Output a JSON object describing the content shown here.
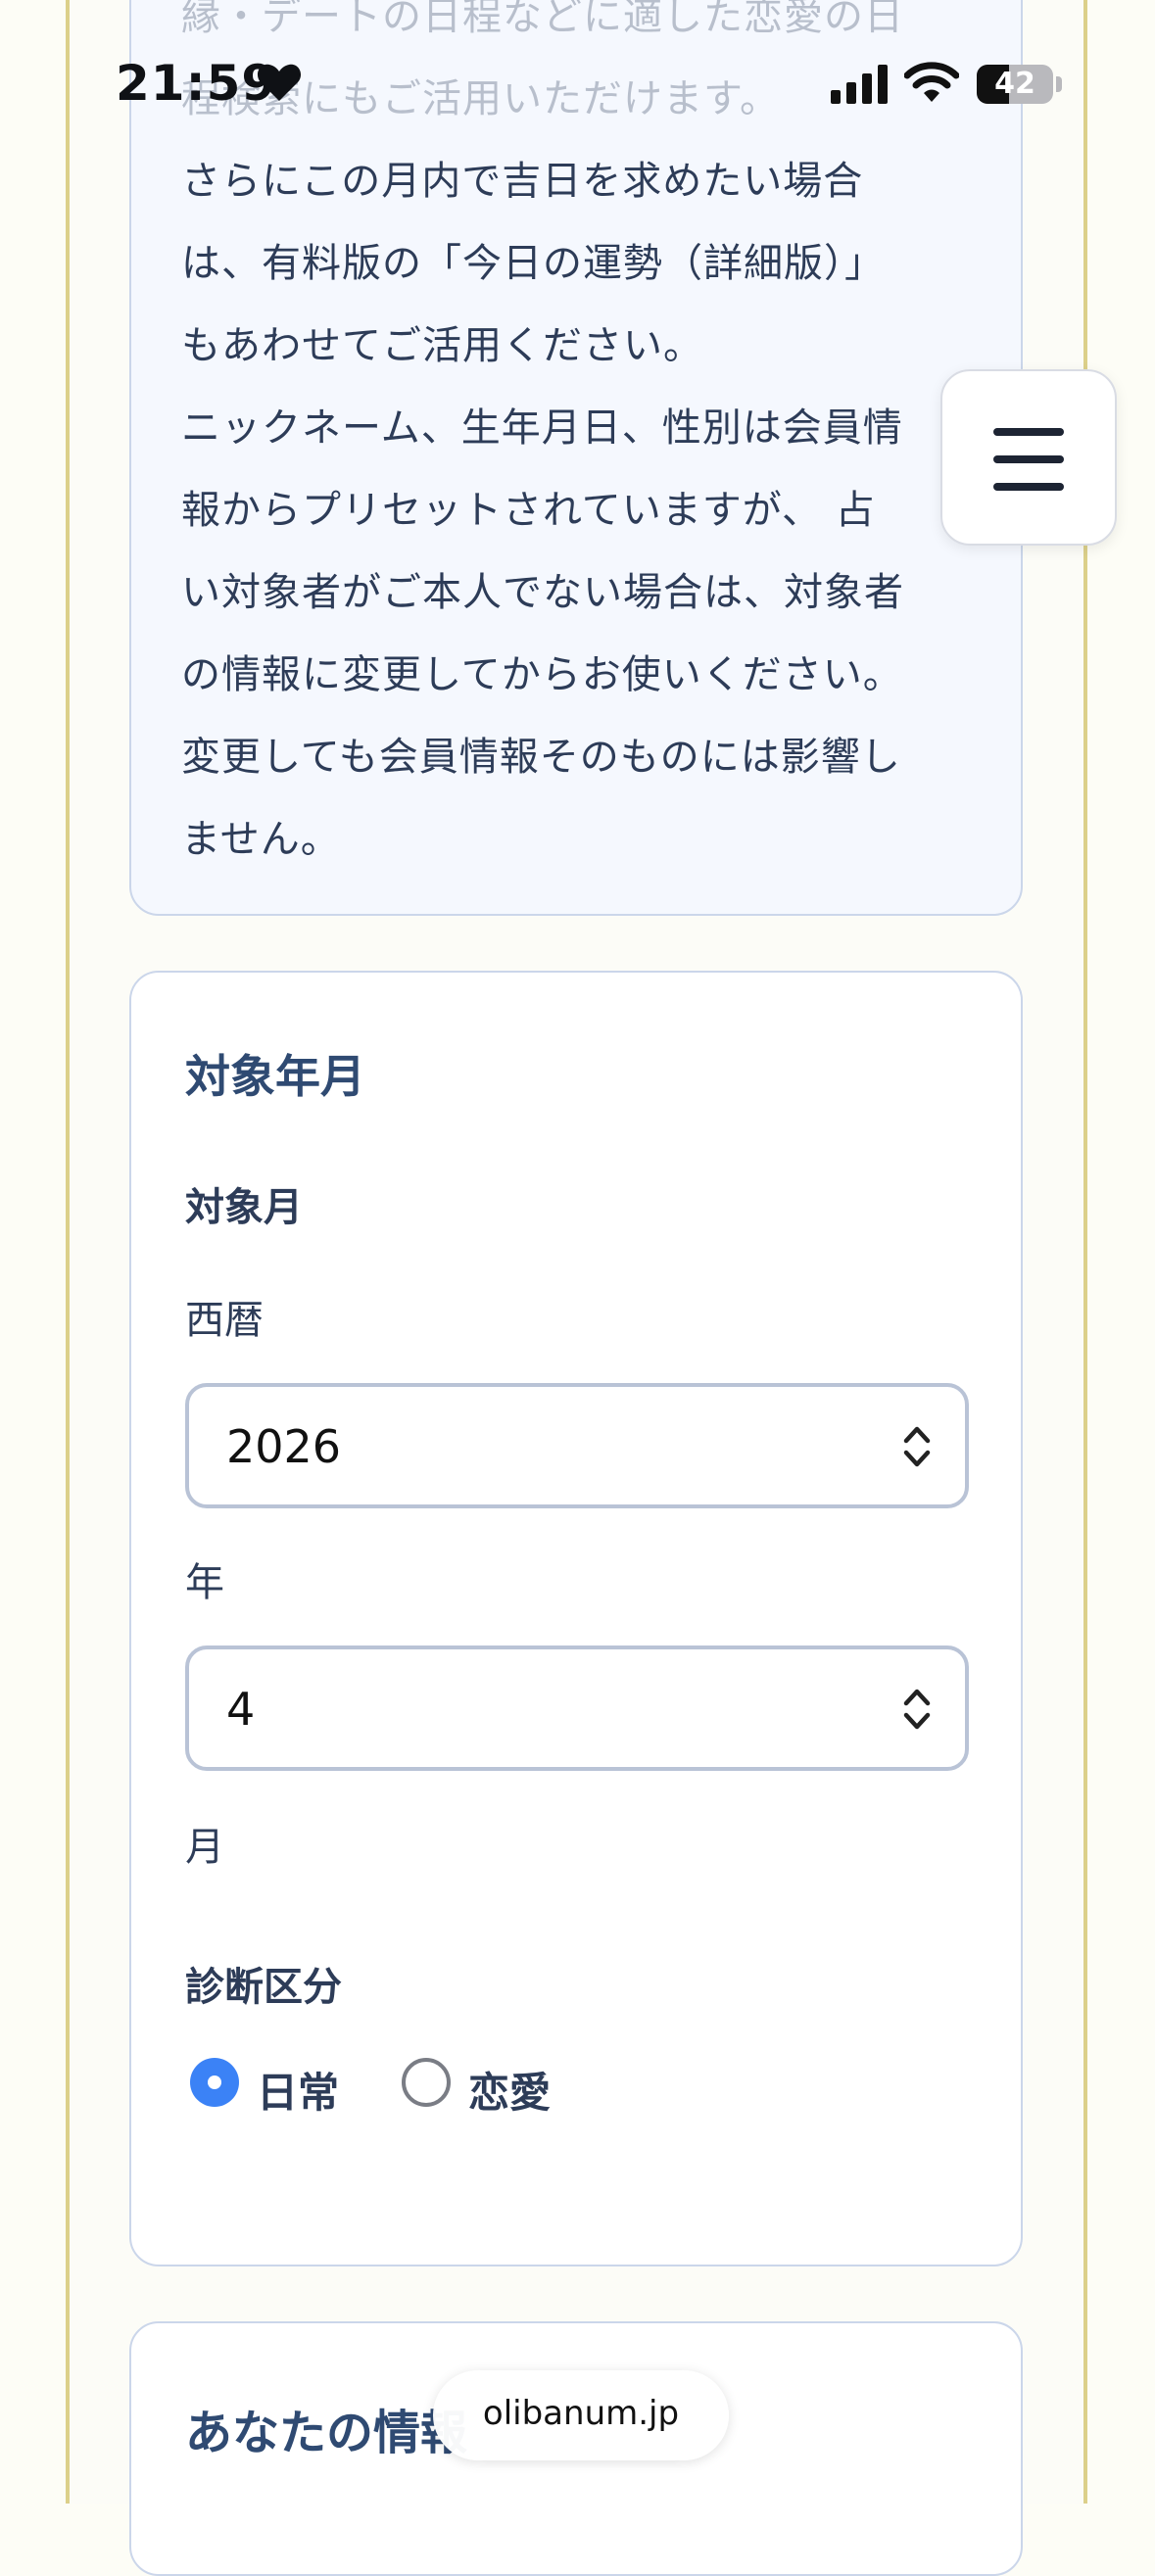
{
  "status_bar": {
    "time": "21:59",
    "battery": "42",
    "battery_level": 0.42
  },
  "info": {
    "lines": [
      "縁・デートの日程などに適した恋愛の日",
      "程検索にもご活用いただけます。",
      "さらにこの月内で吉日を求めたい場合",
      "は、有料版の「今日の運勢（詳細版）」",
      "もあわせてご活用ください。",
      "ニックネーム、生年月日、性別は会員情",
      "報からプリセットされていますが、 占",
      "い対象者がご本人でない場合は、対象者",
      "の情報に変更してからお使いください。",
      "変更しても会員情報そのものには影響し",
      "ません。"
    ]
  },
  "menu": {
    "icon": "hamburger-icon"
  },
  "form": {
    "section_title": "対象年月",
    "subsection_title": "対象月",
    "year_prefix_label": "西暦",
    "year_value": "2026",
    "year_suffix_label": "年",
    "month_value": "4",
    "month_suffix_label": "月",
    "category_title": "診断区分",
    "options": [
      {
        "label": "日常",
        "selected": true
      },
      {
        "label": "恋愛",
        "selected": false
      }
    ]
  },
  "next_section": {
    "title": "あなたの情報"
  },
  "browser": {
    "url": "olibanum.jp"
  },
  "colors": {
    "accent": "#3b82f6",
    "card_border": "#cbd6ea",
    "info_bg": "#f5f8fe",
    "frame": "#dcd08a"
  }
}
